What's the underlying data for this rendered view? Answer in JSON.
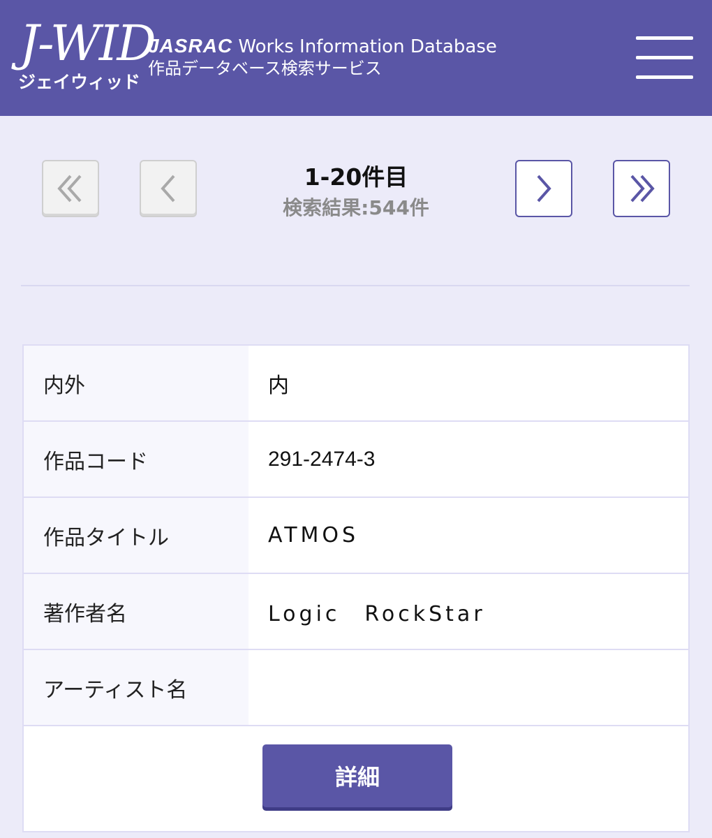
{
  "header": {
    "logo": "J-WID",
    "logo_kana": "ジェイウィッド",
    "brand_jasrac": "JASRAC",
    "brand_rest": "Works Information Database",
    "subtitle": "作品データベース検索サービス",
    "menu_icon": "hamburger-menu-icon",
    "bg_color": "#5a56a6"
  },
  "pager": {
    "first_icon": "double-chevron-left-icon",
    "prev_icon": "chevron-left-icon",
    "next_icon": "chevron-right-icon",
    "last_icon": "double-chevron-right-icon",
    "range": "1-20件目",
    "total": "検索結果:544件"
  },
  "result": {
    "rows": [
      {
        "label": "内外",
        "value": "内"
      },
      {
        "label": "作品コード",
        "value": "291-2474-3"
      },
      {
        "label": "作品タイトル",
        "value": "ATMOS"
      },
      {
        "label": "著作者名",
        "value": "Logic　RockStar"
      },
      {
        "label": "アーティスト名",
        "value": ""
      }
    ],
    "detail_button": "詳細"
  }
}
